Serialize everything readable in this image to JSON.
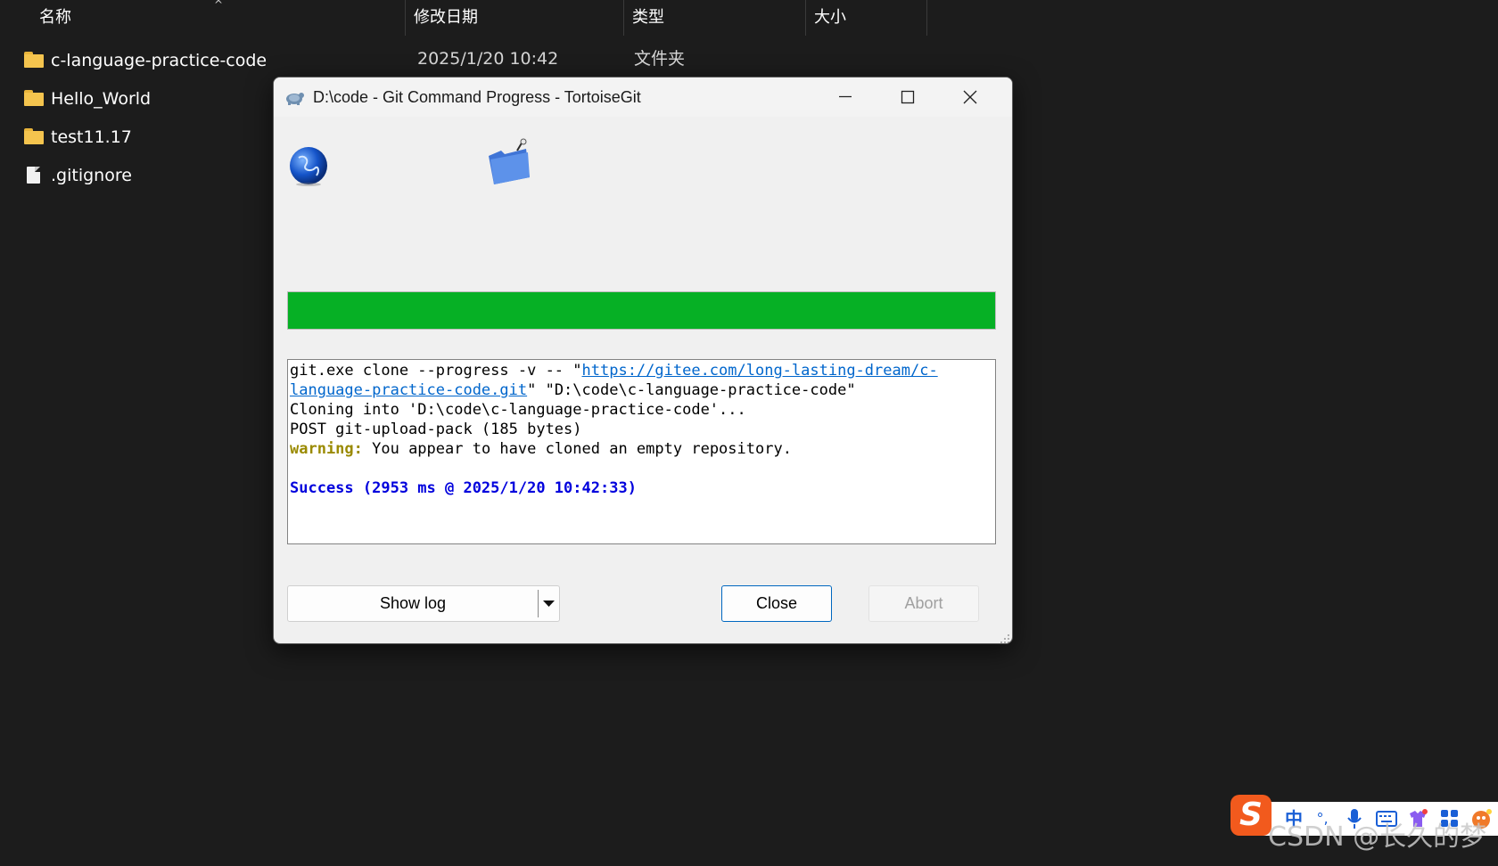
{
  "explorer": {
    "columns": {
      "name": "名称",
      "modified": "修改日期",
      "type": "类型",
      "size": "大小"
    },
    "rows": [
      {
        "name": "c-language-practice-code",
        "date": "2025/1/20 10:42",
        "type": "文件夹",
        "icon": "folder-icon"
      },
      {
        "name": "Hello_World",
        "icon": "folder-icon"
      },
      {
        "name": "test11.17",
        "icon": "folder-icon"
      },
      {
        "name": ".gitignore",
        "icon": "file-icon"
      }
    ]
  },
  "dialog": {
    "title": "D:\\code - Git Command Progress - TortoiseGit",
    "progress_percent": 100,
    "progress_color": "#06b025",
    "log": {
      "line1_prefix": "git.exe clone --progress -v -- \"",
      "line1_link": "https://gitee.com/long-lasting-dream/c-",
      "line2_link": "language-practice-code.git",
      "line2_suffix": "\" \"D:\\code\\c-language-practice-code\"",
      "line3": "Cloning into 'D:\\code\\c-language-practice-code'...",
      "line4": "POST git-upload-pack (185 bytes)",
      "warning_label": "warning:",
      "warning_text": " You appear to have cloned an empty repository.",
      "success": "Success (2953 ms @ 2025/1/20 10:42:33)"
    },
    "buttons": {
      "show_log": "Show log",
      "close": "Close",
      "abort": "Abort"
    }
  },
  "ime": {
    "logo": "S",
    "mode": "中",
    "punct": "°,"
  },
  "watermark": "CSDN @长久的梦"
}
